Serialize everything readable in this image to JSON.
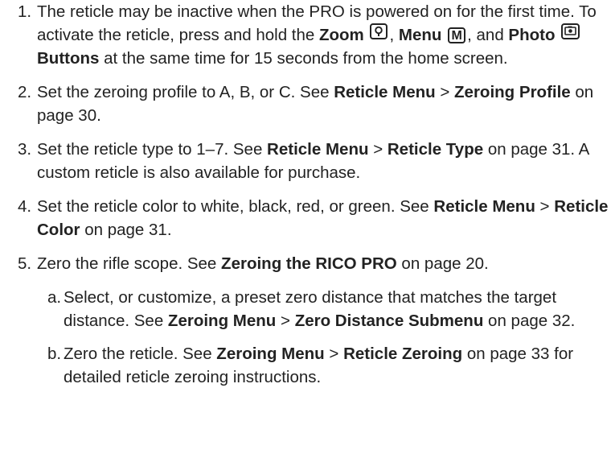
{
  "items": [
    {
      "num": "1.",
      "t1": "The reticle may be inactive when the PRO is powered on for the first time. To activate the reticle, press and hold the ",
      "b1": "Zoom",
      "zoom_icon": "magnifier-icon",
      "t2": ", ",
      "b2": "Menu",
      "menu_key": "M",
      "t3": ", and ",
      "b3": "Photo",
      "photo_icon": "camera-icon",
      "b4": "Buttons",
      "t4": " at the same time for 15 seconds from the home screen."
    },
    {
      "num": "2.",
      "t1": "Set the zeroing profile to A, B, or C. See ",
      "b1": "Reticle Menu",
      "t2": " > ",
      "b2": "Zeroing Profile",
      "t3": " on page 30."
    },
    {
      "num": "3.",
      "t1": "Set the reticle type to 1–7. See ",
      "b1": "Reticle Menu",
      "t2": " > ",
      "b2": "Reticle Type",
      "t3": " on page 31. A custom reticle is also available for purchase."
    },
    {
      "num": "4.",
      "t1": "Set the reticle color to white, black, red, or green. See ",
      "b1": "Reticle Menu",
      "t2": " > ",
      "b2": "Reticle Color",
      "t3": " on page 31."
    },
    {
      "num": "5.",
      "t1": "Zero the rifle scope. See ",
      "b1": "Zeroing the RICO PRO",
      "t2": " on page 20."
    }
  ],
  "subitems": [
    {
      "num": "a.",
      "t1": "Select, or customize, a preset zero distance that matches the target distance. See ",
      "b1": "Zeroing Menu",
      "t2": " > ",
      "b2": "Zero Distance Submenu",
      "t3": " on page 32."
    },
    {
      "num": "b.",
      "t1": "Zero the reticle. See ",
      "b1": "Zeroing Menu",
      "t2": " > ",
      "b2": "Reticle Zeroing",
      "t3": " on page 33 for detailed reticle zeroing instructions."
    }
  ]
}
